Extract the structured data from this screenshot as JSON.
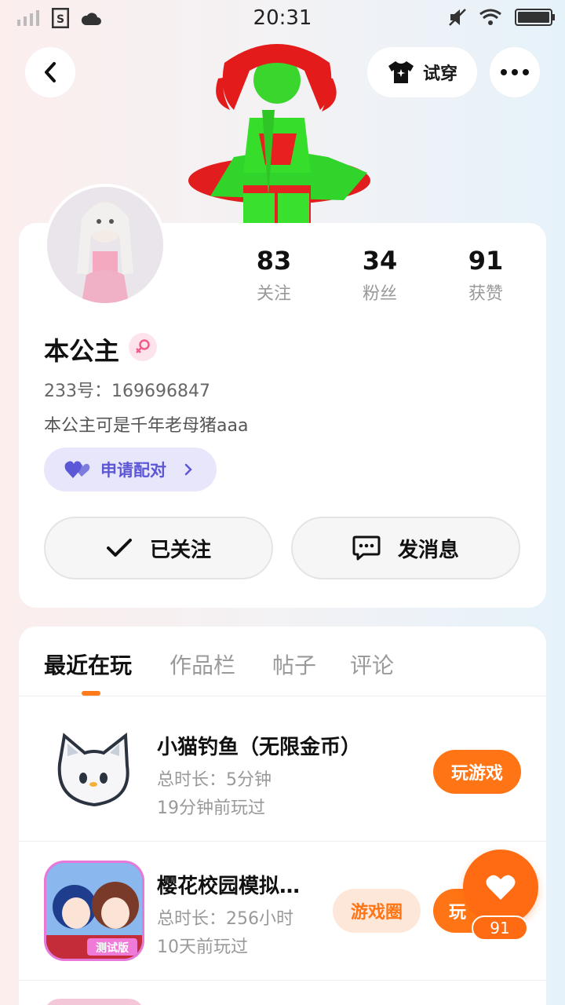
{
  "status_bar": {
    "time": "20:31"
  },
  "header": {
    "tryon_label": "试穿"
  },
  "stats": [
    {
      "value": "83",
      "label": "关注"
    },
    {
      "value": "34",
      "label": "粉丝"
    },
    {
      "value": "91",
      "label": "获赞"
    }
  ],
  "profile": {
    "name": "本公主",
    "uid": "233号：169696847",
    "bio": "本公主可是千年老母猪aaa",
    "pair_label": "申请配对"
  },
  "actions": {
    "followed_label": "已关注",
    "message_label": "发消息"
  },
  "tabs": [
    {
      "label": "最近在玩"
    },
    {
      "label": "作品栏"
    },
    {
      "label": "帖子"
    },
    {
      "label": "评论"
    }
  ],
  "games": [
    {
      "title": "小猫钓鱼（无限金币）",
      "duration": "总时长：5分钟",
      "last_played": "19分钟前玩过",
      "play_label": "玩游戏"
    },
    {
      "title": "樱花校园模拟…",
      "duration": "总时长：256小时",
      "last_played": "10天前玩过",
      "circle_label": "游戏圈",
      "play_label": "玩",
      "badge": "测试版"
    }
  ],
  "fab": {
    "count": "91"
  },
  "colors": {
    "accent": "#ff7414",
    "pair": "#5b57d6"
  }
}
